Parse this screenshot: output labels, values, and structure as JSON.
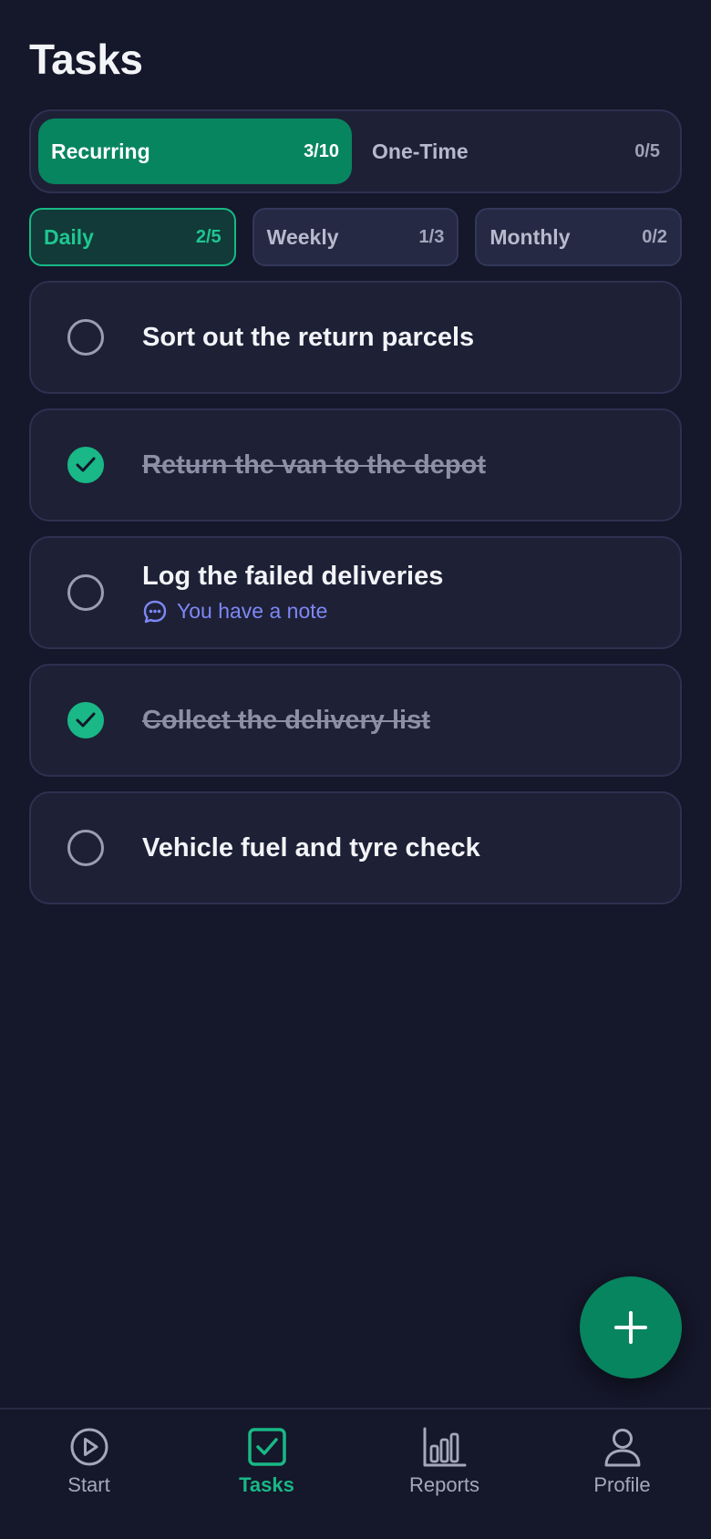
{
  "header": {
    "title": "Tasks"
  },
  "segment": [
    {
      "label": "Recurring",
      "count": "3/10"
    },
    {
      "label": "One-Time",
      "count": "0/5"
    }
  ],
  "filters": [
    {
      "label": "Daily",
      "count": "2/5"
    },
    {
      "label": "Weekly",
      "count": "1/3"
    },
    {
      "label": "Monthly",
      "count": "0/2"
    }
  ],
  "tasks": [
    {
      "title": "Sort out the return parcels",
      "done": false
    },
    {
      "title": "Return the van to the depot",
      "done": true
    },
    {
      "title": "Log the failed deliveries",
      "done": false,
      "note": "You have a note"
    },
    {
      "title": "Collect the delivery list",
      "done": true
    },
    {
      "title": "Vehicle fuel and tyre check",
      "done": false
    }
  ],
  "fab": {
    "icon": "plus-icon"
  },
  "tabbar": [
    {
      "label": "Start",
      "icon": "play-circle-icon"
    },
    {
      "label": "Tasks",
      "icon": "checkbox-icon"
    },
    {
      "label": "Reports",
      "icon": "bar-chart-icon"
    },
    {
      "label": "Profile",
      "icon": "user-icon"
    }
  ],
  "colors": {
    "background": "#15172a",
    "accent": "#07855f",
    "accent_bright": "#19b886",
    "note": "#7d88f5"
  }
}
